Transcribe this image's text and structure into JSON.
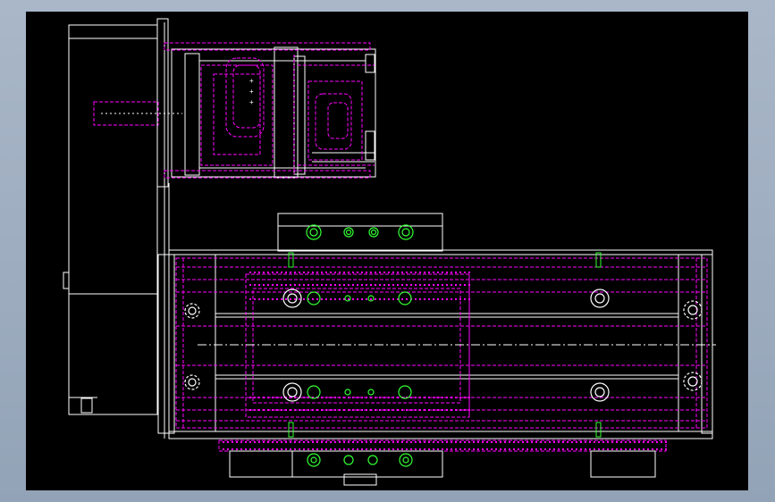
{
  "view": {
    "background_color": "#000000",
    "frame_color": "#a3b1c3"
  },
  "palette": {
    "outline": "#ffffff",
    "hidden": "#ff00ff",
    "holes": "#33ff33",
    "centerline": "#ffffff"
  },
  "entities": [
    "motor-housing",
    "motor-flange",
    "coupling-housing",
    "motor-shaft",
    "slide-table",
    "base-rail",
    "linear-guide-top",
    "linear-guide-bottom",
    "end-plate-left",
    "end-plate-right",
    "mounting-foot-left",
    "mounting-foot-center",
    "mounting-foot-right",
    "lead-screw-centerline"
  ]
}
